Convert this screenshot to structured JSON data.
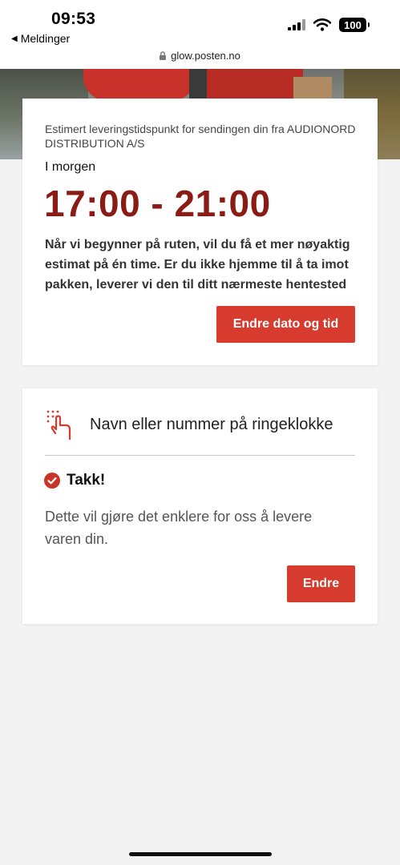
{
  "status_bar": {
    "time": "09:53",
    "back_label": "Meldinger",
    "battery": "100",
    "url": "glow.posten.no"
  },
  "icons": {
    "back": "back-arrow-icon",
    "signal": "cellular-signal-icon",
    "wifi": "wifi-icon",
    "battery": "battery-icon",
    "lock": "lock-icon",
    "doorbell": "doorbell-hand-icon",
    "check": "checkmark-circle-icon"
  },
  "colors": {
    "brand_red": "#d63b2e",
    "time_red": "#8b1c15",
    "background": "#f3f3f3"
  },
  "delivery_card": {
    "estimate_label": "Estimert leveringstidspunkt for sendingen din fra AUDIONORD DISTRIBUTION A/S",
    "day": "I morgen",
    "time_window": "17:00 - 21:00",
    "info": "Når vi begynner på ruten, vil du få et mer nøyaktig estimat på én time. Er du ikke hjemme til å ta imot pakken, leverer vi den til ditt nærmeste hentested",
    "button_label": "Endre dato og tid"
  },
  "doorbell_card": {
    "title": "Navn eller nummer på ringeklokke",
    "confirmation": "Takk!",
    "message": "Dette vil gjøre det enklere for oss å levere varen din.",
    "button_label": "Endre"
  }
}
